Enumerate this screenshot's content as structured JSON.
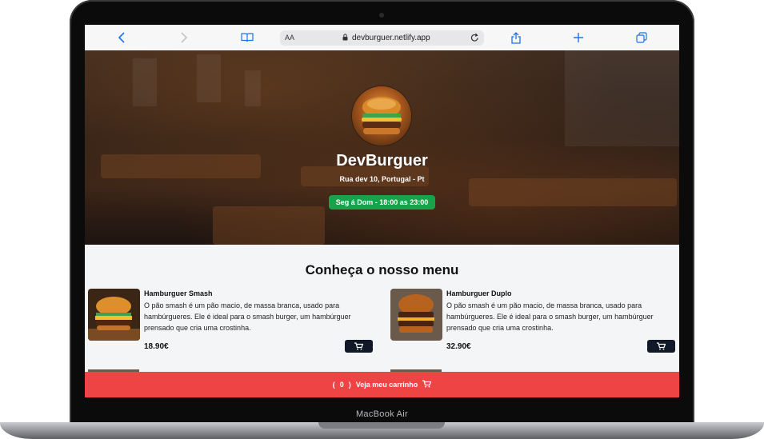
{
  "device": {
    "model_label": "MacBook Air"
  },
  "browser": {
    "text_size_label": "AA",
    "url": "devburguer.netlify.app"
  },
  "hero": {
    "title": "DevBurguer",
    "address": "Rua dev 10, Portugal - Pt",
    "hours": "Seg á Dom - 18:00 as 23:00",
    "hours_color": "#16a34a"
  },
  "menu": {
    "title": "Conheça o nosso menu",
    "items": [
      {
        "name": "Hamburguer Smash",
        "description": "O pão smash é um pão macio, de massa branca, usado para hambúrgueres. Ele é ideal para o smash burger, um hambúrguer prensado que cria uma crostinha.",
        "price": "18.90€"
      },
      {
        "name": "Hamburguer Duplo",
        "description": "O pão smash é um pão macio, de massa branca, usado para hambúrgueres. Ele é ideal para o smash burger, um hambúrguer prensado que cria uma crostinha.",
        "price": "32.90€"
      }
    ]
  },
  "cart": {
    "open_paren": "(",
    "count": "0",
    "close_paren": ")",
    "label": "Veja meu carrinho",
    "bar_color": "#ef4444"
  },
  "icons": [
    "back-icon",
    "forward-icon",
    "book-icon",
    "lock-icon",
    "reload-icon",
    "share-icon",
    "plus-icon",
    "tabs-icon",
    "cart-icon"
  ]
}
